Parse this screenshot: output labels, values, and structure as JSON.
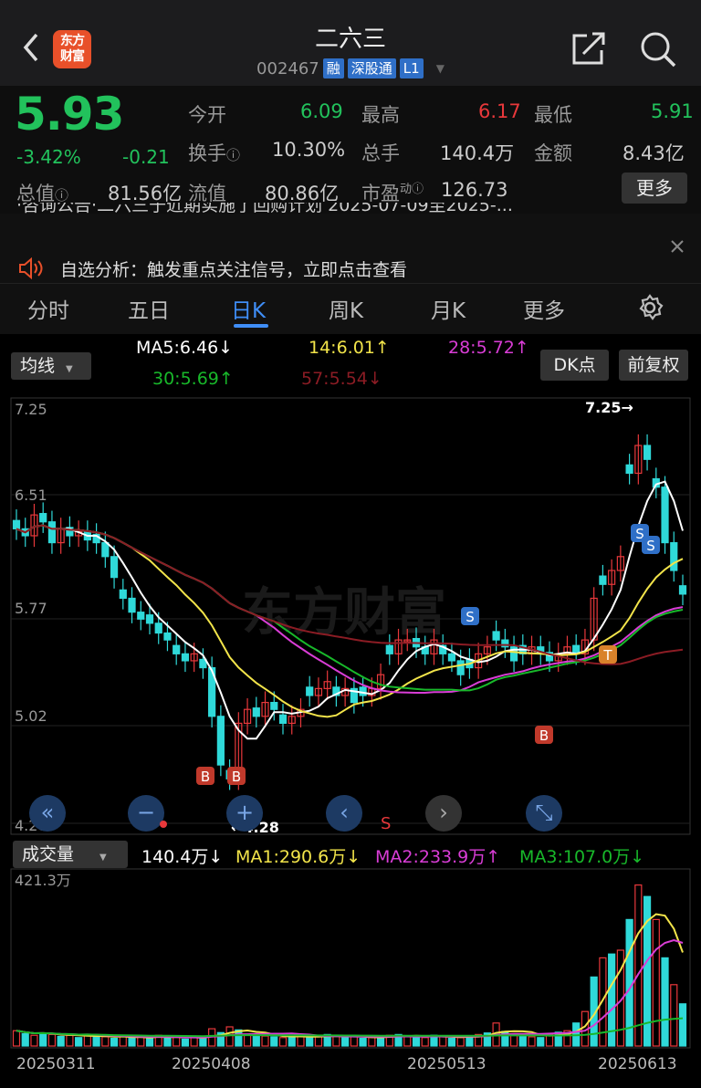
{
  "header": {
    "title": "二六三",
    "code": "002467",
    "tags": [
      "融",
      "深股通",
      "L1"
    ],
    "logo": "东方\n财富"
  },
  "quote": {
    "price": "5.93",
    "pct": "-3.42%",
    "chg": "-0.21",
    "rows": [
      [
        {
          "l": "今开",
          "v": "6.09",
          "c": "g"
        },
        {
          "l": "最高",
          "v": "6.17",
          "c": "r"
        },
        {
          "l": "最低",
          "v": "5.91",
          "c": "g"
        }
      ],
      [
        {
          "l": "换手",
          "v": "10.30%",
          "c": ""
        },
        {
          "l": "总手",
          "v": "140.4万",
          "c": ""
        },
        {
          "l": "金额",
          "v": "8.43亿",
          "c": ""
        }
      ],
      [
        {
          "l": "流值",
          "v": "80.86亿",
          "c": ""
        },
        {
          "l": "市盈",
          "v": "126.73",
          "c": ""
        }
      ]
    ],
    "total_label": "总值",
    "total_value": "81.56亿",
    "more": "更多"
  },
  "news": {
    "line1": "·咨询公告·二六三于近期实施了回购计划 2025-07-09至2025-...",
    "line2": "自选分析：触发重点关注信号，立即点击查看"
  },
  "tabs": [
    "分时",
    "五日",
    "日K",
    "周K",
    "月K",
    "更多"
  ],
  "indicator": {
    "selector": "均线",
    "ma5": "MA5:6.46↓",
    "ma14": "14:6.01↑",
    "ma28": "28:5.72↑",
    "ma30": "30:5.69↑",
    "ma57": "57:5.54↓",
    "dk": "DK点",
    "fq": "前复权"
  },
  "kline": {
    "y_labels": [
      "7.25",
      "6.51",
      "5.77",
      "5.02",
      "4.28"
    ],
    "high_label": "7.25→",
    "low_label": "←4.28"
  },
  "volume": {
    "selector": "成交量",
    "vol": "140.4万↓",
    "ma1": "MA1:290.6万↓",
    "ma2": "MA2:233.9万↑",
    "ma3": "MA3:107.0万↓",
    "max": "421.3万"
  },
  "dates": [
    "20250311",
    "20250408",
    "20250513",
    "20250613"
  ],
  "colors": {
    "up": "#e8383b",
    "down": "#2fd9d9",
    "ma5": "#ffffff",
    "ma14": "#f2e44a",
    "ma28": "#d93dd6",
    "ma30": "#18b82a",
    "ma57": "#8b1c24"
  }
}
